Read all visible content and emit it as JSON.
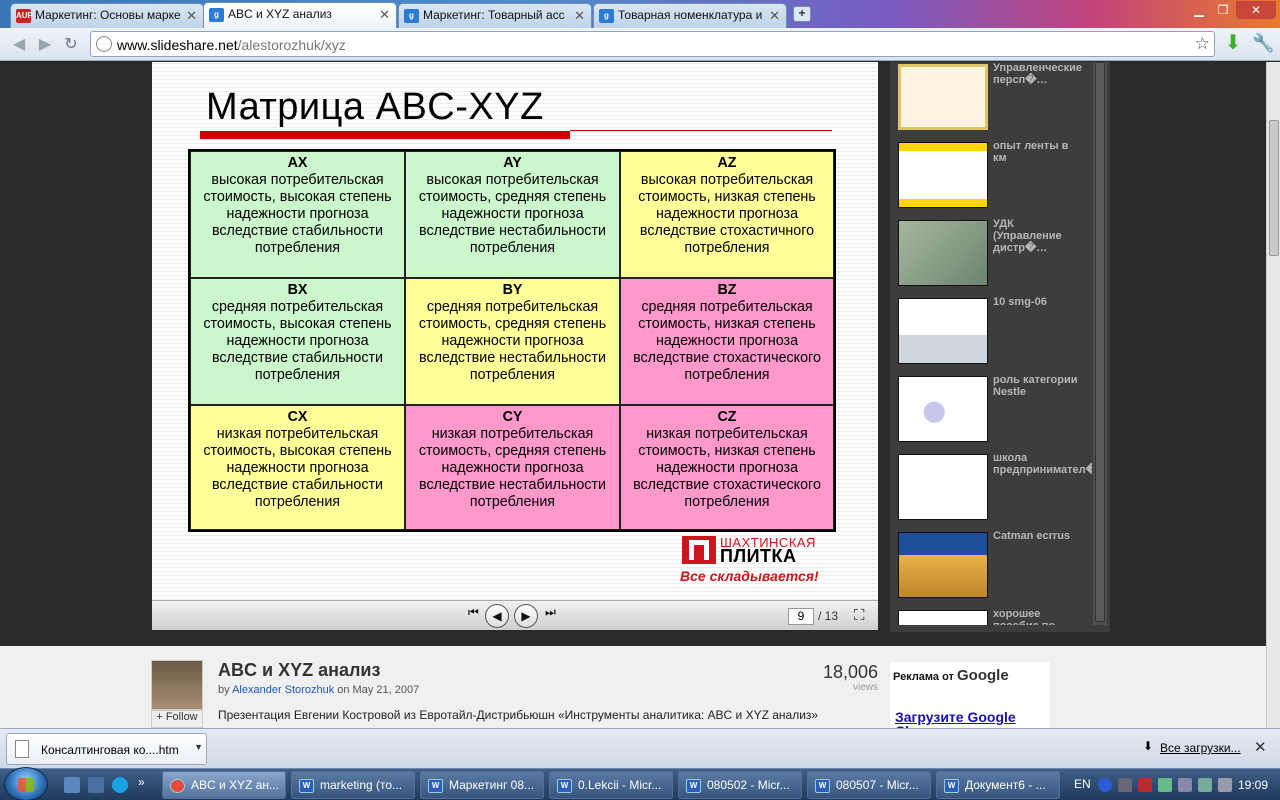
{
  "browser": {
    "tabs": [
      {
        "title": "Маркетинг: Основы марке",
        "favicon": "AUP",
        "favicon_color": "#cc2222"
      },
      {
        "title": "ABC и XYZ анализ",
        "favicon": "g",
        "favicon_color": "#2b7ad6",
        "active": true
      },
      {
        "title": "Маркетинг: Товарный асс",
        "favicon": "g",
        "favicon_color": "#2b7ad6"
      },
      {
        "title": "Товарная номенклатура и",
        "favicon": "g",
        "favicon_color": "#2b7ad6"
      }
    ],
    "url_domain": "www.slideshare.net",
    "url_path": "/alestorozhuk/xyz"
  },
  "slide": {
    "title": "Матрица ABC-XYZ",
    "cells": [
      {
        "code": "AX",
        "text": "высокая потребительская стоимость, высокая степень надежности прогноза вследствие стабильности потребления",
        "color": "#ccf7cc"
      },
      {
        "code": "AY",
        "text": "высокая потребительская стоимость, средняя степень надежности прогноза вследствие нестабильности потребления",
        "color": "#ccf7cc"
      },
      {
        "code": "AZ",
        "text": "высокая потребительская стоимость, низкая степень надежности прогноза вследствие стохастичного потребления",
        "color": "#ffff99"
      },
      {
        "code": "BX",
        "text": "средняя потребительская стоимость, высокая степень надежности прогноза вследствие стабильности потребления",
        "color": "#ccf7cc"
      },
      {
        "code": "BY",
        "text": "средняя потребительская стоимость, средняя степень надежности прогноза вследствие нестабильности потребления",
        "color": "#ffff99"
      },
      {
        "code": "BZ",
        "text": "средняя потребительская стоимость, низкая степень надежности прогноза вследствие стохастического потребления",
        "color": "#ff99cc"
      },
      {
        "code": "CX",
        "text": "низкая потребительская стоимость, высокая степень надежности прогноза вследствие стабильности потребления",
        "color": "#ffff99"
      },
      {
        "code": "CY",
        "text": "низкая потребительская стоимость, средняя степень надежности прогноза вследствие нестабильности потребления",
        "color": "#ff99cc"
      },
      {
        "code": "CZ",
        "text": "низкая потребительская стоимость, низкая степень надежности прогноза вследствие стохастического потребления",
        "color": "#ff99cc"
      }
    ],
    "logo_line1": "ШАХТИНСКАЯ",
    "logo_line2": "ПЛИТКА",
    "logo_slogan": "Все складывается!"
  },
  "player": {
    "current_page": "9",
    "total": "/ 13"
  },
  "related": [
    {
      "title": "Управленческие персп�…"
    },
    {
      "title": "опыт ленты в км"
    },
    {
      "title": "УДК (Управление дистр�…"
    },
    {
      "title": "10 smg-06"
    },
    {
      "title": "роль категории Nestle"
    },
    {
      "title": "школа предпринимател�…"
    },
    {
      "title": "Catman ecrrus"
    },
    {
      "title": "хорошее пособие по"
    }
  ],
  "meta": {
    "title": "ABC и XYZ анализ",
    "by": "by",
    "author": "Alexander Storozhuk",
    "date": "on May 21, 2007",
    "follow": "+ Follow",
    "description": "Презентация Евгении Костровой из Евротайл-Дистрибьюшн «Инструменты аналитика: ABC и XYZ анализ»",
    "views_count": "18,006",
    "views_label": "views"
  },
  "ad": {
    "label": "Реклама от",
    "brand": "Google",
    "link": "Загрузите Google Chrome"
  },
  "download_shelf": {
    "file": "Консалтинговая ко....htm",
    "all_label": "Все загрузки..."
  },
  "taskbar": {
    "tasks": [
      {
        "label": "ABC и XYZ ан...",
        "active": true
      },
      {
        "label": "marketing (то..."
      },
      {
        "label": "Маркетинг 08..."
      },
      {
        "label": "0.Lekcii - Micr..."
      },
      {
        "label": "080502 - Micr..."
      },
      {
        "label": "080507 - Micr..."
      },
      {
        "label": "Документ6 - ..."
      }
    ],
    "lang": "EN",
    "clock": "19:09"
  }
}
